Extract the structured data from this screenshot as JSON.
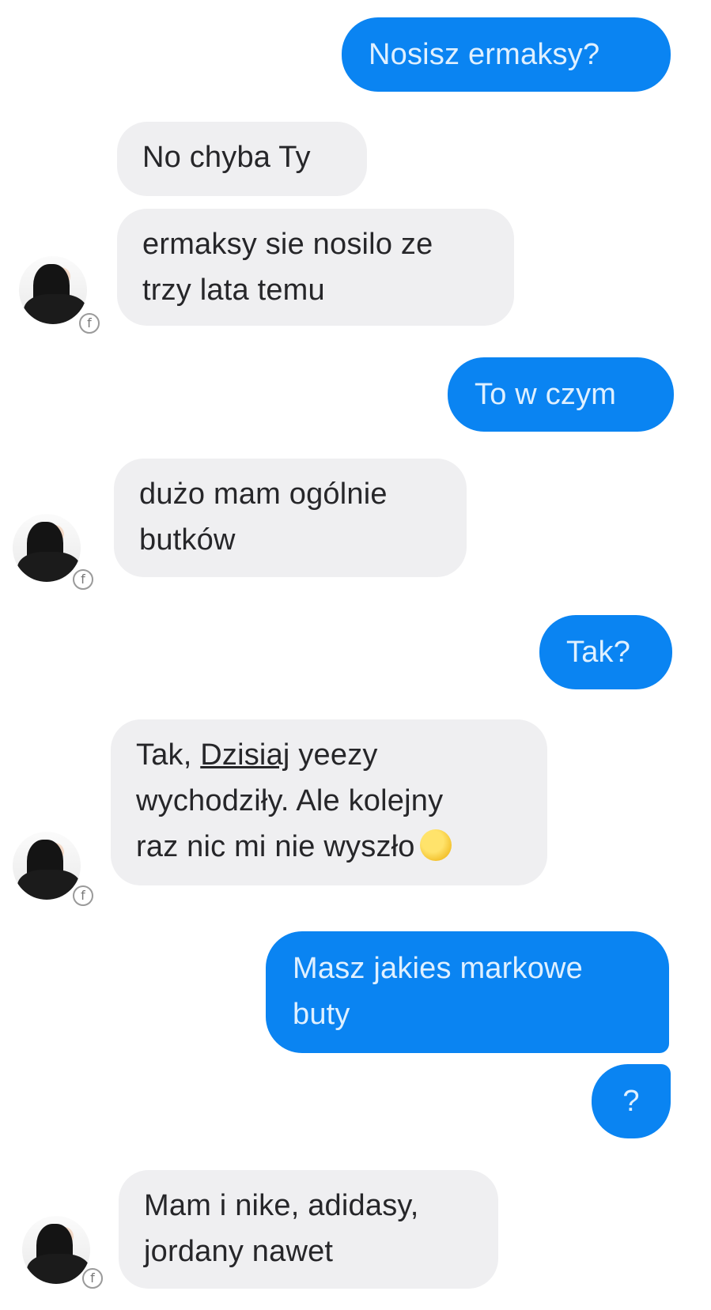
{
  "messages": [
    {
      "dir": "out",
      "lines": [
        "Nosisz ermaksy?"
      ]
    },
    {
      "dir": "in",
      "lines": [
        "No chyba Ty"
      ]
    },
    {
      "dir": "in",
      "lines": [
        "ermaksy sie nosilo ze",
        "trzy lata temu"
      ]
    },
    {
      "dir": "out",
      "lines": [
        "To w czym"
      ]
    },
    {
      "dir": "in",
      "lines": [
        "dużo mam ogólnie",
        "butków"
      ]
    },
    {
      "dir": "out",
      "lines": [
        "Tak?"
      ]
    },
    {
      "dir": "in",
      "lines": [
        "Tak, Dzisiaj yeezy",
        "wychodziły. Ale kolejny",
        "raz nic mi nie wyszło"
      ],
      "emoji": "slightly-frowning-face"
    },
    {
      "dir": "out",
      "lines": [
        "Masz jakies markowe",
        "buty"
      ]
    },
    {
      "dir": "out",
      "lines": [
        "?"
      ]
    },
    {
      "dir": "in",
      "lines": [
        "Mam i nike, adidasy,",
        "jordany nawet"
      ]
    }
  ],
  "msg7_parts": {
    "prefix": "Tak, ",
    "underlined": "Dzisiaj",
    "suffix": " yeezy"
  },
  "badge_glyph": "f",
  "colors": {
    "outgoing_bubble": "#0a84f2",
    "incoming_bubble": "#efeff1",
    "incoming_text": "#262629",
    "outgoing_text": "#dff0ff"
  }
}
